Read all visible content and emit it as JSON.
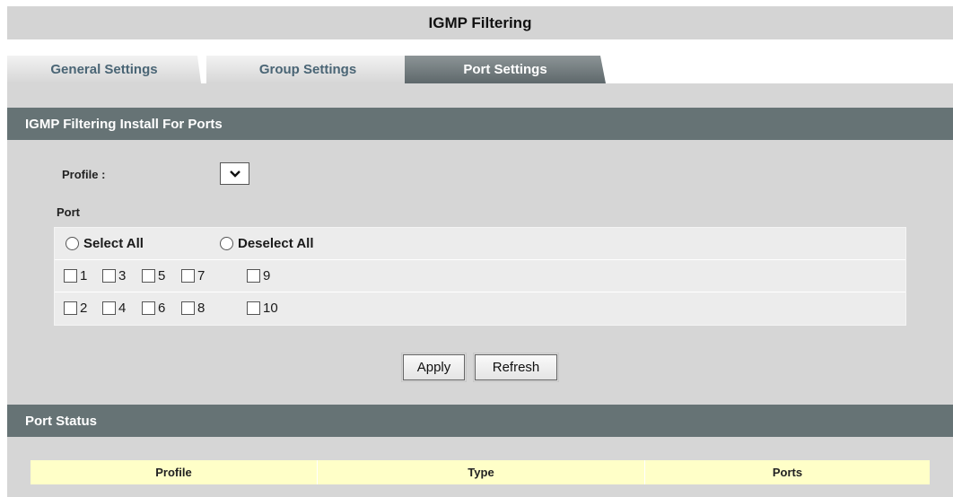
{
  "header": {
    "title": "IGMP Filtering"
  },
  "tabs": [
    {
      "label": "General Settings",
      "active": false
    },
    {
      "label": "Group Settings",
      "active": false
    },
    {
      "label": "Port Settings",
      "active": true
    }
  ],
  "install_section": {
    "title": "IGMP Filtering Install For Ports",
    "profile_label": "Profile :",
    "profile_value": "",
    "port_label": "Port",
    "select_all_label": "Select All",
    "deselect_all_label": "Deselect All",
    "ports_row1": [
      "1",
      "3",
      "5",
      "7",
      "9"
    ],
    "ports_row2": [
      "2",
      "4",
      "6",
      "8",
      "10"
    ]
  },
  "buttons": {
    "apply": "Apply",
    "refresh": "Refresh"
  },
  "status_section": {
    "title": "Port Status",
    "columns": [
      "Profile",
      "Type",
      "Ports"
    ]
  },
  "colors": {
    "section_bar": "#667375",
    "active_tab": "#6e777a",
    "table_header": "#ffffc8",
    "background": "#d6d6d6"
  }
}
